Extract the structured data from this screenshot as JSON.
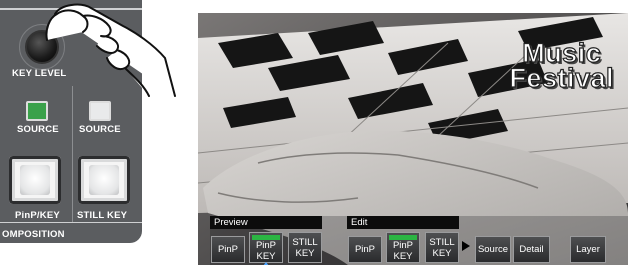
{
  "panel": {
    "knob_label": "KEY LEVEL",
    "source_left_label": "SOURCE",
    "source_right_label": "SOURCE",
    "pinp_key_label": "PinP/KEY",
    "still_key_label": "STILL KEY",
    "section_label": "OMPOSITION",
    "source_left_led": "green",
    "source_right_led": "white",
    "colors": {
      "panel_bg": "#5b5d60",
      "led_green": "#3aa14a"
    }
  },
  "monitor": {
    "title_line1": "Music",
    "title_line2": "Festival"
  },
  "ui": {
    "preview": {
      "label": "Preview",
      "buttons": [
        {
          "label": "PinP",
          "active": false
        },
        {
          "label": "PinP KEY",
          "line1": "PinP",
          "line2": "KEY",
          "active": true
        },
        {
          "label": "STILL KEY",
          "line1": "STILL",
          "line2": "KEY",
          "active": false
        }
      ]
    },
    "edit": {
      "label": "Edit",
      "buttons": [
        {
          "label": "PinP",
          "active": false
        },
        {
          "label": "PinP KEY",
          "line1": "PinP",
          "line2": "KEY",
          "active": true
        },
        {
          "label": "STILL KEY",
          "line1": "STILL",
          "line2": "KEY",
          "active": false
        }
      ]
    },
    "actions": {
      "source": "Source",
      "detail": "Detail",
      "layer": "Layer"
    },
    "colors": {
      "active_indicator": "#2bb543"
    }
  }
}
